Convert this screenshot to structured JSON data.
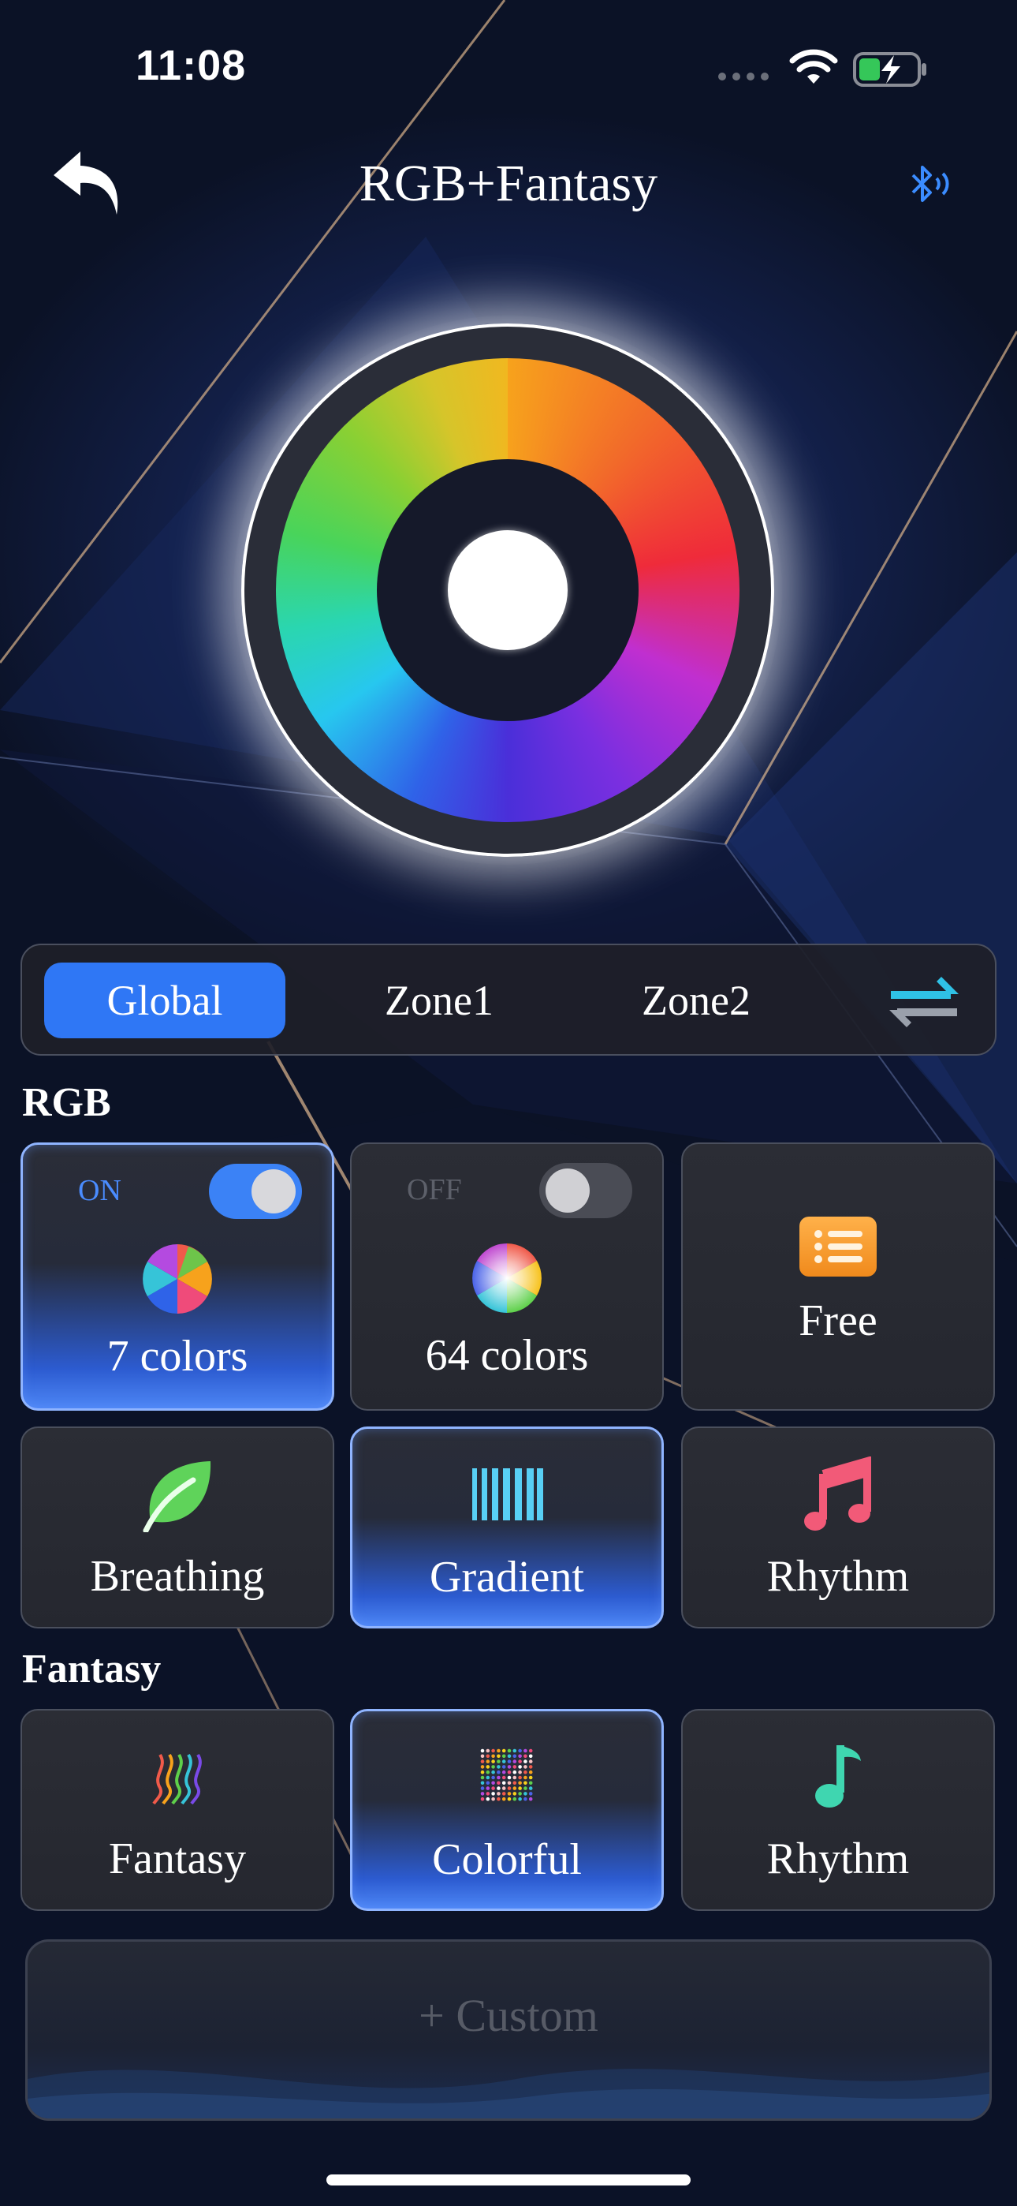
{
  "status_bar": {
    "time": "11:08"
  },
  "header": {
    "title": "RGB+Fantasy"
  },
  "zones": {
    "tabs": [
      "Global",
      "Zone1",
      "Zone2"
    ],
    "active": "Global"
  },
  "rgb": {
    "section_label": "RGB",
    "tiles": [
      {
        "label": "7 colors",
        "toggle_text": "ON",
        "toggle_on": true,
        "selected": true,
        "icon": "color-pie-icon"
      },
      {
        "label": "64 colors",
        "toggle_text": "OFF",
        "toggle_on": false,
        "selected": false,
        "icon": "color-wheel-icon"
      },
      {
        "label": "Free",
        "selected": false,
        "icon": "list-icon"
      },
      {
        "label": "Breathing",
        "selected": false,
        "icon": "leaf-icon"
      },
      {
        "label": "Gradient",
        "selected": true,
        "icon": "gradient-bars-icon"
      },
      {
        "label": "Rhythm",
        "selected": false,
        "icon": "music-notes-icon"
      }
    ]
  },
  "fantasy": {
    "section_label": "Fantasy",
    "tiles": [
      {
        "label": "Fantasy",
        "selected": false,
        "icon": "rainbow-waves-icon"
      },
      {
        "label": "Colorful",
        "selected": true,
        "icon": "dot-grid-icon"
      },
      {
        "label": "Rhythm",
        "selected": false,
        "icon": "music-note-icon"
      }
    ]
  },
  "custom": {
    "label": "+ Custom"
  },
  "colors": {
    "accent": "#2f77f5",
    "toggle_on": "#3b82f6",
    "tile_bg": "#2b2d35",
    "bluetooth": "#3b8cff"
  }
}
